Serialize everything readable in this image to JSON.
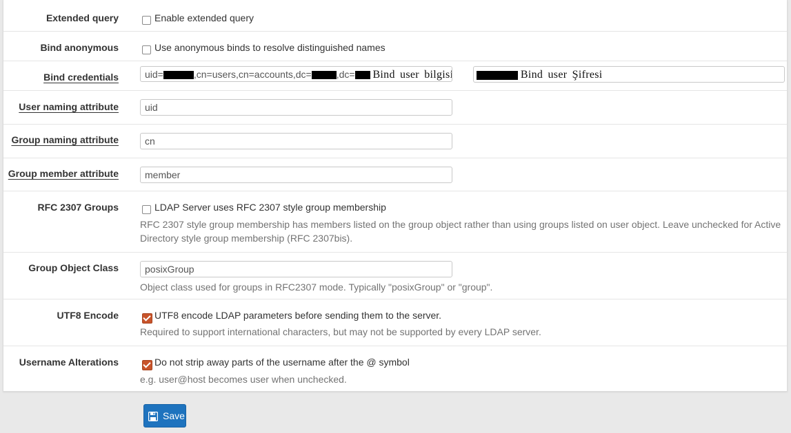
{
  "fields": {
    "extended_query": {
      "label": "Extended query",
      "checkbox_text": "Enable extended query",
      "checked": false
    },
    "bind_anonymous": {
      "label": "Bind anonymous",
      "checkbox_text": "Use anonymous binds to resolve distinguished names",
      "checked": false
    },
    "bind_credentials": {
      "label": "Bind credentials",
      "user_prefix": "uid=",
      "user_seg1": ",cn=users,cn=accounts,dc=",
      "user_seg2": ",dc=",
      "user_annotation": "Bind user bilgisi",
      "password_annotation": "Bind user Şifresi"
    },
    "user_naming_attribute": {
      "label": "User naming attribute",
      "value": "uid"
    },
    "group_naming_attribute": {
      "label": "Group naming attribute",
      "value": "cn"
    },
    "group_member_attribute": {
      "label": "Group member attribute",
      "value": "member"
    },
    "rfc2307_groups": {
      "label": "RFC 2307 Groups",
      "checkbox_text": "LDAP Server uses RFC 2307 style group membership",
      "checked": false,
      "help": "RFC 2307 style group membership has members listed on the group object rather than using groups listed on user object. Leave unchecked for Active Directory style group membership (RFC 2307bis)."
    },
    "group_object_class": {
      "label": "Group Object Class",
      "value": "posixGroup",
      "help": "Object class used for groups in RFC2307 mode. Typically \"posixGroup\" or \"group\"."
    },
    "utf8_encode": {
      "label": "UTF8 Encode",
      "checkbox_text": "UTF8 encode LDAP parameters before sending them to the server.",
      "checked": true,
      "help": "Required to support international characters, but may not be supported by every LDAP server."
    },
    "username_alterations": {
      "label": "Username Alterations",
      "checkbox_text": "Do not strip away parts of the username after the @ symbol",
      "checked": true,
      "help": "e.g. user@host becomes user when unchecked."
    }
  },
  "actions": {
    "save_label": "Save",
    "save_icon": "floppy-disk-icon"
  },
  "colors": {
    "accent": "#1e73be",
    "checkbox_checked": "#c8542b"
  }
}
